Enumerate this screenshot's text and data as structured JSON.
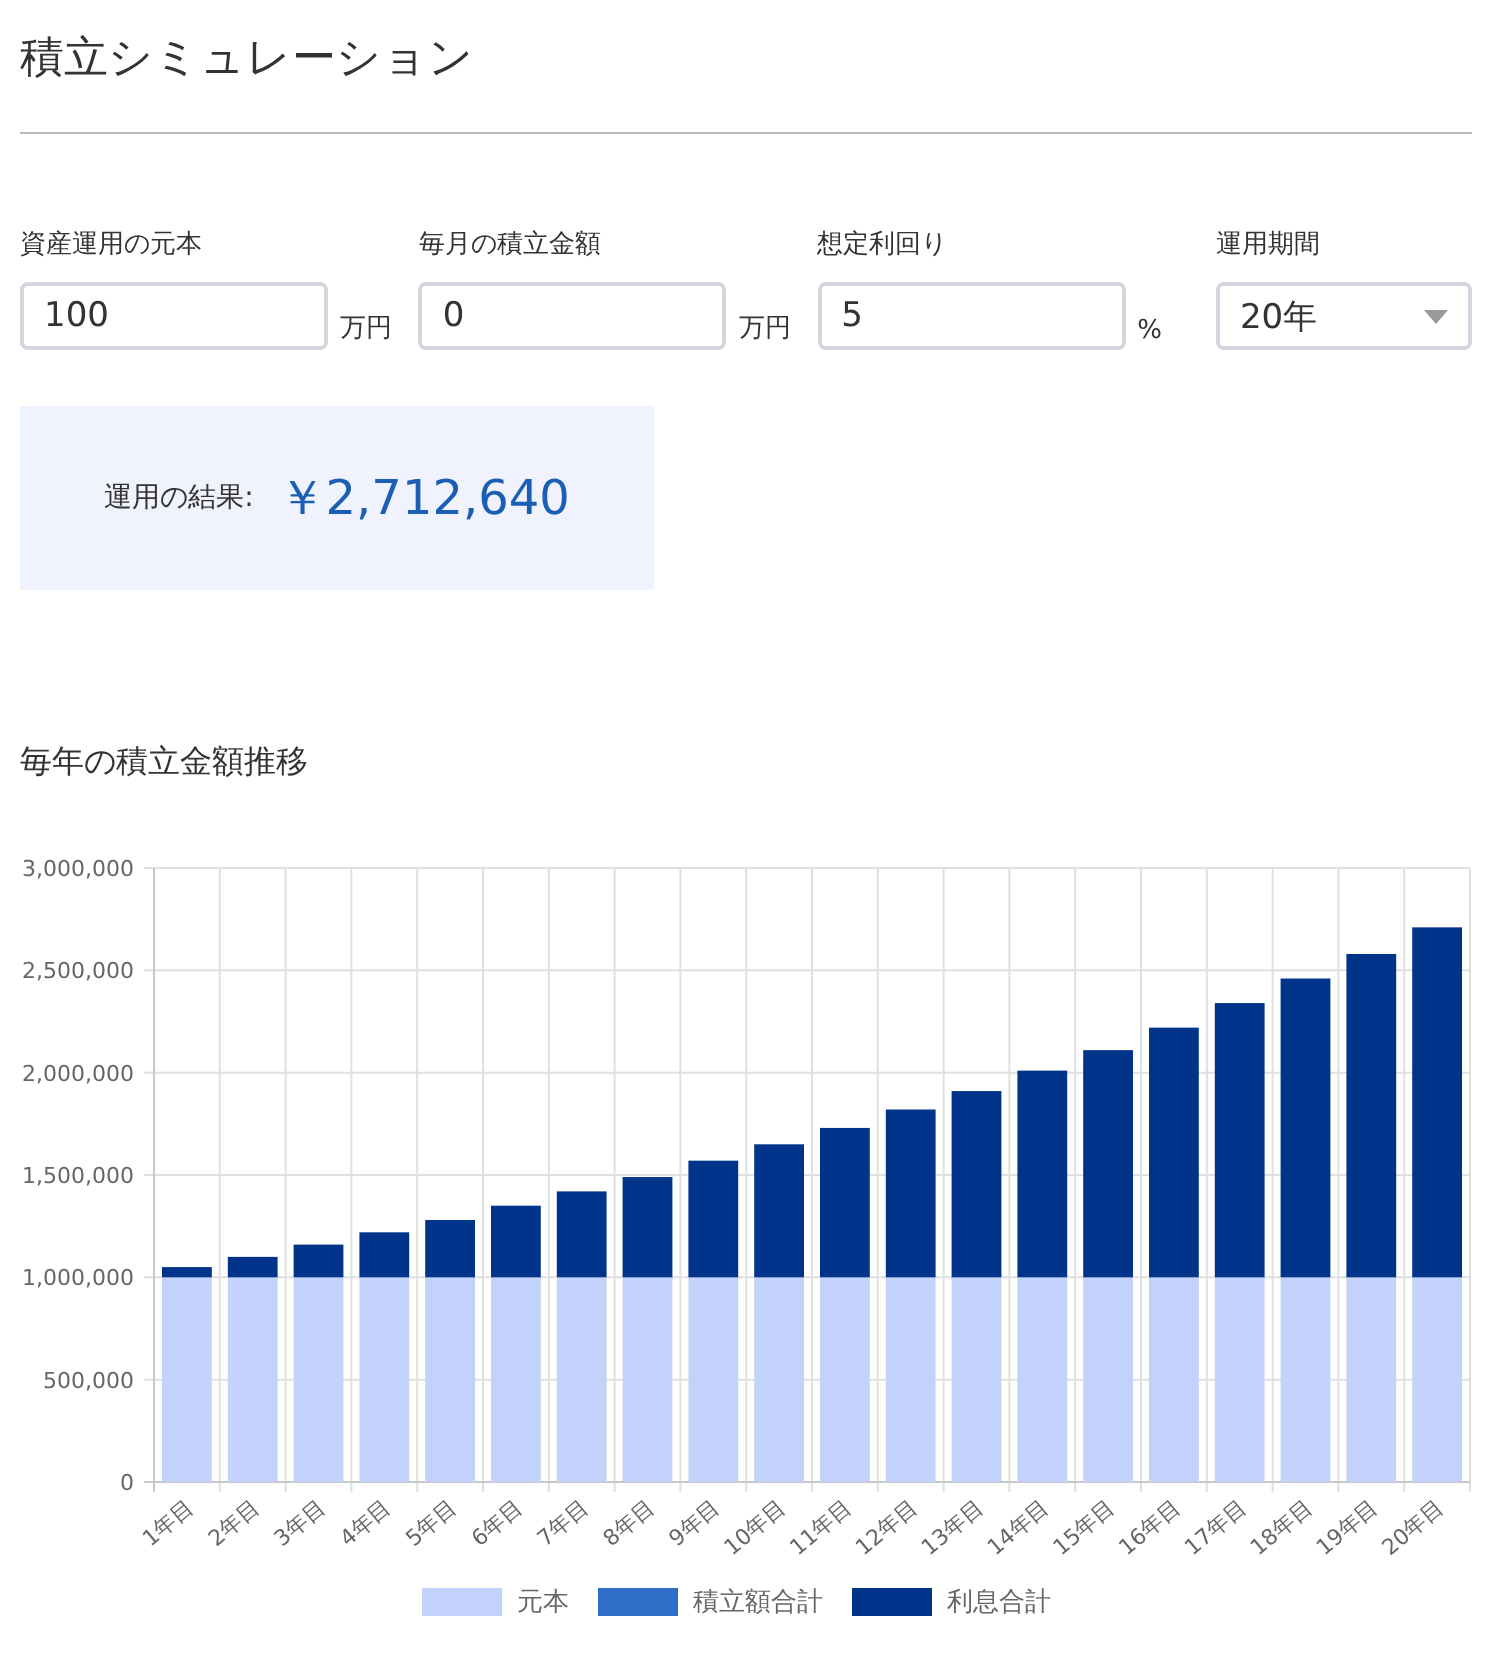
{
  "title": "積立シミュレーション",
  "fields": [
    {
      "kind": "input",
      "label": "資産運用の元本",
      "value": "100",
      "unit": "万円"
    },
    {
      "kind": "input",
      "label": "毎月の積立金額",
      "value": "0",
      "unit": "万円"
    },
    {
      "kind": "input",
      "label": "想定利回り",
      "value": "5",
      "unit": "%"
    },
    {
      "kind": "select",
      "label": "運用期間",
      "value": "20年"
    }
  ],
  "result": {
    "label": "運用の結果:",
    "value": "￥2,712,640"
  },
  "chart_title": "毎年の積立金額推移",
  "chart_data": {
    "type": "bar",
    "stacked": true,
    "grid": true,
    "legend": true,
    "categories": [
      "1年目",
      "2年目",
      "3年目",
      "4年目",
      "5年目",
      "6年目",
      "7年目",
      "8年目",
      "9年目",
      "10年目",
      "11年目",
      "12年目",
      "13年目",
      "14年目",
      "15年目",
      "16年目",
      "17年目",
      "18年目",
      "19年目",
      "20年目"
    ],
    "series": [
      {
        "name": "元本",
        "color": "#c2d2fa",
        "values": [
          1000000,
          1000000,
          1000000,
          1000000,
          1000000,
          1000000,
          1000000,
          1000000,
          1000000,
          1000000,
          1000000,
          1000000,
          1000000,
          1000000,
          1000000,
          1000000,
          1000000,
          1000000,
          1000000,
          1000000
        ]
      },
      {
        "name": "積立額合計",
        "color": "#2f6fca",
        "values": [
          0,
          0,
          0,
          0,
          0,
          0,
          0,
          0,
          0,
          0,
          0,
          0,
          0,
          0,
          0,
          0,
          0,
          0,
          0,
          0
        ]
      },
      {
        "name": "利息合計",
        "color": "#00348a",
        "values": [
          50000,
          100000,
          160000,
          220000,
          280000,
          350000,
          420000,
          490000,
          570000,
          650000,
          730000,
          820000,
          910000,
          1010000,
          1110000,
          1220000,
          1340000,
          1460000,
          1580000,
          1710000
        ]
      }
    ],
    "ylim": [
      0,
      3000000
    ],
    "yticks": [
      {
        "value": 0,
        "label": "0"
      },
      {
        "value": 500000,
        "label": "500,000"
      },
      {
        "value": 1000000,
        "label": "1,000,000"
      },
      {
        "value": 1500000,
        "label": "1,500,000"
      },
      {
        "value": 2000000,
        "label": "2,000,000"
      },
      {
        "value": 2500000,
        "label": "2,500,000"
      },
      {
        "value": 3000000,
        "label": "3,000,000"
      }
    ]
  }
}
